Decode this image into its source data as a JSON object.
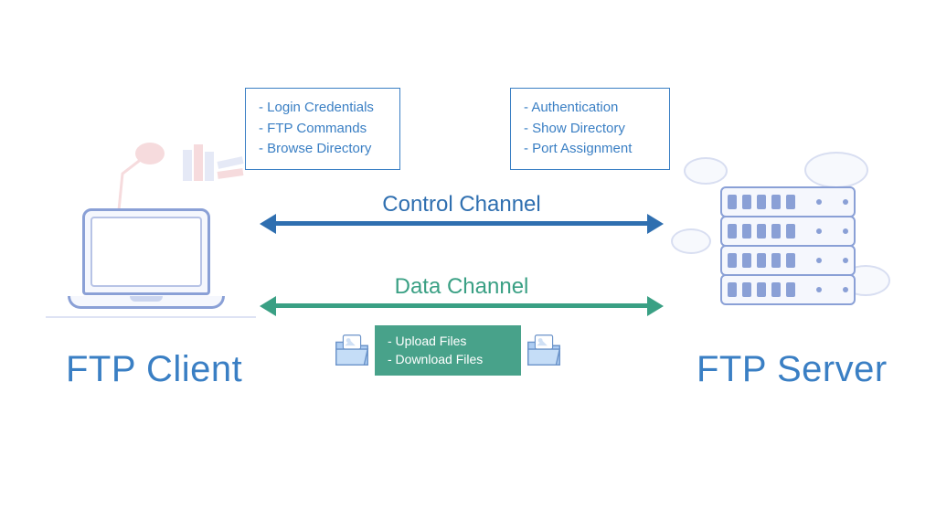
{
  "client": {
    "label": "FTP Client",
    "box_items": [
      "- Login Credentials",
      "- FTP Commands",
      "- Browse Directory"
    ]
  },
  "server": {
    "label": "FTP Server",
    "box_items": [
      "- Authentication",
      "- Show Directory",
      "- Port Assignment"
    ]
  },
  "channels": {
    "control": {
      "label": "Control Channel",
      "color": "#2f6fb0"
    },
    "data": {
      "label": "Data Channel",
      "color": "#3aa084"
    }
  },
  "data_files": {
    "items": [
      "- Upload Files",
      "- Download Files"
    ]
  },
  "icons": {
    "folder_left": "folder-icon",
    "folder_right": "folder-icon"
  }
}
